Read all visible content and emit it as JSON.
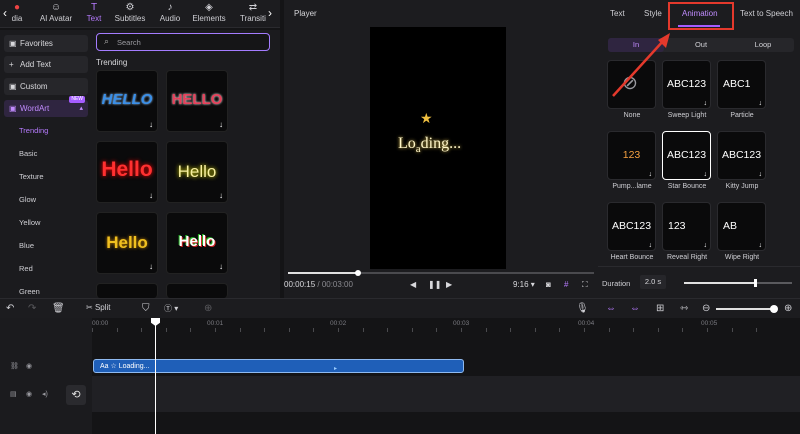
{
  "toolbar": {
    "tabs": [
      {
        "label": "dia",
        "icon": "media-icon"
      },
      {
        "label": "AI Avatar",
        "icon": "avatar-icon"
      },
      {
        "label": "Text",
        "icon": "text-icon"
      },
      {
        "label": "Subtitles",
        "icon": "subtitles-icon"
      },
      {
        "label": "Audio",
        "icon": "audio-icon"
      },
      {
        "label": "Elements",
        "icon": "elements-icon"
      },
      {
        "label": "Transiti",
        "icon": "transition-icon"
      }
    ]
  },
  "sidenav": {
    "favorites": "Favorites",
    "add_text": "Add Text",
    "custom": "Custom",
    "wordart": "WordArt",
    "new_badge": "NEW",
    "subs": [
      "Trending",
      "Basic",
      "Texture",
      "Glow",
      "Yellow",
      "Blue",
      "Red",
      "Green"
    ]
  },
  "content": {
    "search_placeholder": "Search",
    "section": "Trending",
    "tiles": [
      "HELLO",
      "HELLO",
      "Hello",
      "Hello",
      "Hello",
      "Hello"
    ]
  },
  "player": {
    "title": "Player",
    "overlay_main": "Lo",
    "overlay_sub": "a",
    "overlay_tail": "ding...",
    "time_current": "00:00:15",
    "time_sep": " / ",
    "time_total": "00:03:00",
    "aspect": "9:16",
    "progress": 0.23
  },
  "right": {
    "tabs": [
      "Text",
      "Style",
      "Animation",
      "Text to Speech"
    ],
    "segments": [
      "In",
      "Out",
      "Loop"
    ],
    "presets": [
      {
        "text": "",
        "label": "None"
      },
      {
        "text": "ABC123",
        "label": "Sweep Light"
      },
      {
        "text": "ABC1",
        "label": "Particle"
      },
      {
        "text": "123",
        "label": "Pump...lame"
      },
      {
        "text": "ABC123",
        "label": "Star Bounce"
      },
      {
        "text": "ABC123",
        "label": "Kitty Jump"
      },
      {
        "text": "ABC123",
        "label": "Heart Bounce"
      },
      {
        "text": "123",
        "label": "Reveal Right"
      },
      {
        "text": "AB",
        "label": "Wipe Right"
      }
    ],
    "duration_label": "Duration",
    "duration_value": "2.0 s"
  },
  "timeline": {
    "split": "Split",
    "ticks": [
      "00:00",
      "00:01",
      "00:02",
      "00:03",
      "00:04",
      "00:05"
    ],
    "clip_label": "Aa ☆ Loading..."
  }
}
